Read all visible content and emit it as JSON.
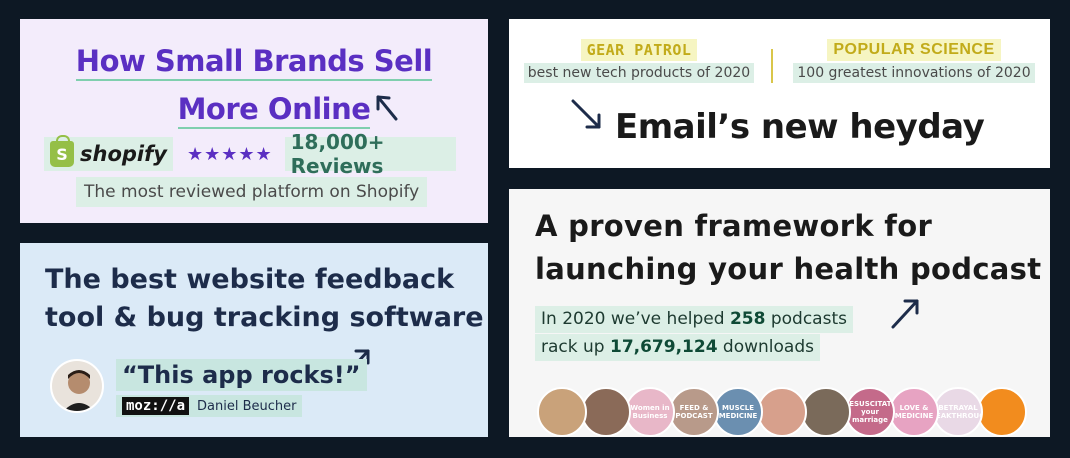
{
  "shopify_card": {
    "title_line1": "How Small Brands Sell",
    "title_line2": "More Online",
    "brand": "shopify",
    "stars": "★★★★★",
    "reviews": "18,000+ Reviews",
    "subtitle": "The most reviewed platform on Shopify"
  },
  "press_card": {
    "gear_patrol": {
      "name": "GEAR PATROL",
      "desc": "best new tech products of 2020"
    },
    "popular_science": {
      "name": "POPULAR SCIENCE",
      "desc": "100 greatest innovations of 2020"
    },
    "headline": "Email’s new heyday"
  },
  "feedback_card": {
    "title_line1": "The best website feedback",
    "title_line2": "tool & bug tracking software",
    "quote": "“This app rocks!”",
    "company": "moz://a",
    "person": "Daniel Beucher"
  },
  "podcast_card": {
    "title_line1": "A proven framework for",
    "title_line2": "launching your health podcast",
    "stat1_prefix": "In 2020 we’ve helped ",
    "stat1_number": "258",
    "stat1_suffix": " podcasts",
    "stat2_prefix": "rack up ",
    "stat2_number": "17,679,124",
    "stat2_suffix": " downloads",
    "covers": [
      {
        "label": "",
        "color": "#c9a27a"
      },
      {
        "label": "",
        "color": "#8a6a58"
      },
      {
        "label": "Women in Business",
        "color": "#e8b7c8"
      },
      {
        "label": "FEED & PODCAST",
        "color": "#b89a8a"
      },
      {
        "label": "MUSCLE MEDICINE",
        "color": "#6b8fb0"
      },
      {
        "label": "",
        "color": "#d7a08c"
      },
      {
        "label": "",
        "color": "#7a6a5a"
      },
      {
        "label": "RESUSCITATE your marriage",
        "color": "#c46a8a"
      },
      {
        "label": "LOVE & MEDICINE",
        "color": "#e7a3c2"
      },
      {
        "label": "BETRAYAL BREAKTHROUGH",
        "color": "#e9d9e6"
      },
      {
        "label": "",
        "color": "#f28c1e"
      }
    ]
  },
  "colors": {
    "background": "#0d1824",
    "shopify_purple": "#5a2fc2",
    "highlight_mint": "#dcefe6",
    "navy": "#1d2c4a"
  }
}
